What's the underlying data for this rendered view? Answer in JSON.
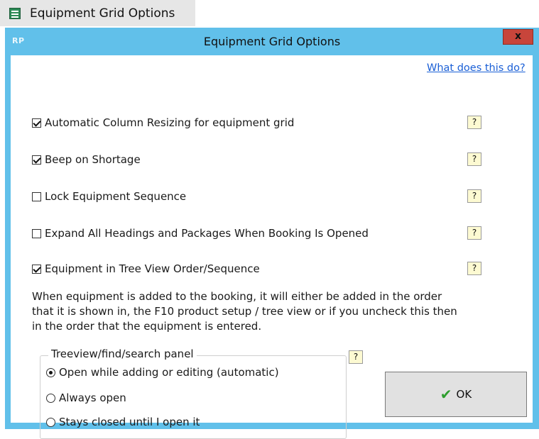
{
  "app": {
    "taskbar_title": "Equipment Grid Options",
    "window_title": "Equipment Grid Options",
    "badge": "RP",
    "close_label": "x"
  },
  "colors": {
    "title_bar": "#61c0ea",
    "close_button": "#c8453b",
    "link": "#1a5fd6",
    "help_bg": "#fdfad2",
    "ok_check": "#2e9e2e"
  },
  "help_link": "What does this do?",
  "help_button_label": "?",
  "options": [
    {
      "label": "Automatic Column Resizing for equipment grid",
      "checked": true
    },
    {
      "label": "Beep on Shortage",
      "checked": true
    },
    {
      "label": "Lock Equipment Sequence",
      "checked": false
    },
    {
      "label": "Expand All Headings and Packages When Booking Is Opened",
      "checked": false
    },
    {
      "label": "Equipment in Tree View Order/Sequence",
      "checked": true
    }
  ],
  "description": {
    "line1": "When equipment is added to the booking,  it will either be added in the order",
    "line2": "that it is shown in, the F10 product setup / tree view or if you uncheck this then",
    "line3": "in the order that the equipment is entered."
  },
  "treeview_panel": {
    "legend": "Treeview/find/search panel",
    "radios": [
      {
        "label": "Open while adding or editing (automatic)",
        "selected": true
      },
      {
        "label": "Always open",
        "selected": false
      },
      {
        "label": "Stays closed until I open it",
        "selected": false
      }
    ]
  },
  "ok_button": {
    "label": "OK",
    "icon": "check-icon"
  }
}
